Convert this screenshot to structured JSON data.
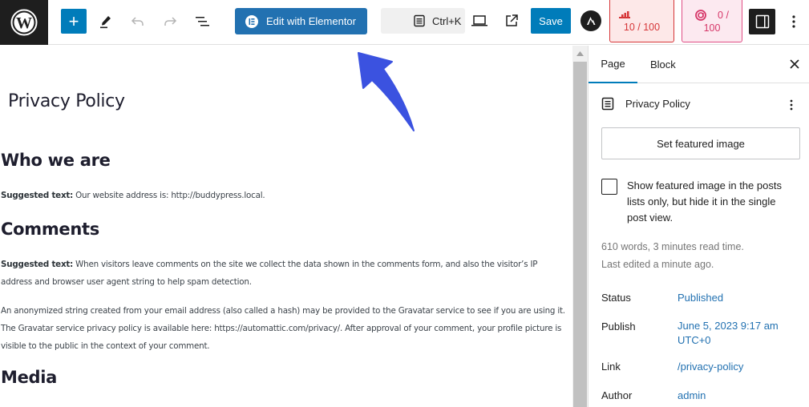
{
  "toolbar": {
    "inserter_label": "+",
    "edit_elementor_label": "Edit with Elementor",
    "command_shortcut": "Ctrl+K",
    "save_label": "Save",
    "seo_score": "10 / 100",
    "readability_score_top": "0 /",
    "readability_score_bottom": "100"
  },
  "editor": {
    "title": "Privacy Policy",
    "sections": [
      {
        "heading": "Who we are"
      },
      {
        "heading": "Comments"
      },
      {
        "heading": "Media"
      }
    ],
    "paragraphs": [
      {
        "prefix": "Suggested text:",
        "text": " Our website address is: http://buddypress.local."
      },
      {
        "prefix": "Suggested text:",
        "text": " When visitors leave comments on the site we collect the data shown in the comments form, and also the visitor’s IP address and browser user agent string to help spam detection."
      },
      {
        "prefix": "",
        "text": "An anonymized string created from your email address (also called a hash) may be provided to the Gravatar service to see if you are using it. The Gravatar service privacy policy is available here: https://automattic.com/privacy/. After approval of your comment, your profile picture is visible to the public in the context of your comment."
      }
    ],
    "annotation_arrow_color": "#3b52e0"
  },
  "sidebar": {
    "tabs": [
      {
        "label": "Page",
        "active": true
      },
      {
        "label": "Block",
        "active": false
      }
    ],
    "document_title": "Privacy Policy",
    "featured_image_button": "Set featured image",
    "featured_checkbox_label": "Show featured image in the posts lists only, but hide it in the single post view.",
    "featured_checkbox_checked": false,
    "word_count": "610 words, 3 minutes read time.",
    "last_edited": "Last edited a minute ago.",
    "properties": [
      {
        "label": "Status",
        "value": "Published"
      },
      {
        "label": "Publish",
        "value": "June 5, 2023 9:17 am UTC+0"
      },
      {
        "label": "Link",
        "value": "/privacy-policy"
      },
      {
        "label": "Author",
        "value": "admin"
      }
    ]
  },
  "colors": {
    "accent": "#007cba",
    "elementor_button": "#2271b1",
    "seo_bad": "#d63638",
    "readability_bad": "#e04f86",
    "link": "#2271b1"
  }
}
